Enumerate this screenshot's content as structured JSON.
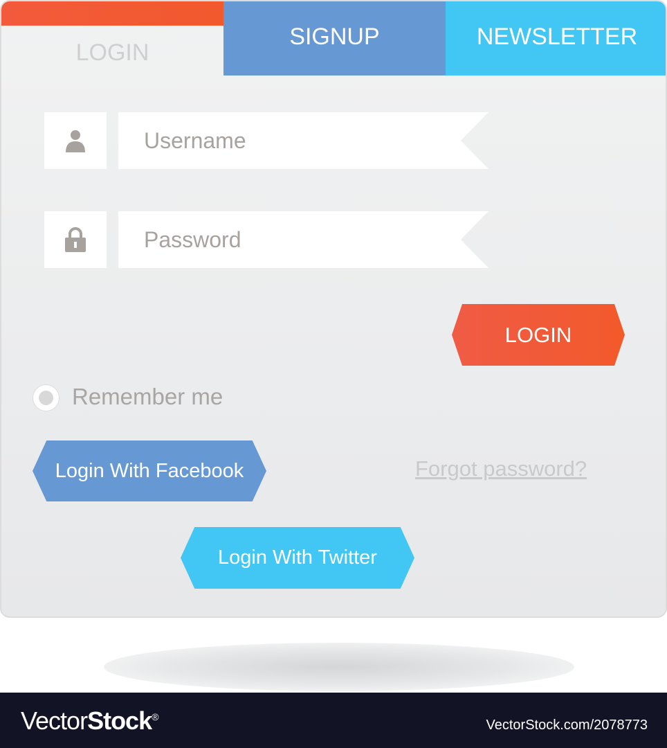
{
  "tabs": [
    {
      "label": "LOGIN",
      "active": true
    },
    {
      "label": "SIGNUP"
    },
    {
      "label": "NEWSLETTER"
    }
  ],
  "form": {
    "username_placeholder": "Username",
    "password_placeholder": "Password",
    "login_button": "LOGIN",
    "remember_me": "Remember me",
    "facebook_button": "Login With Facebook",
    "forgot_password": "Forgot password?",
    "twitter_button": "Login With Twitter"
  },
  "icons": {
    "username": "user-icon",
    "password": "lock-icon"
  },
  "colors": {
    "orange": "#f25a3a",
    "blue": "#6699d3",
    "cyan": "#42c6f4",
    "footer": "#121325"
  },
  "footer": {
    "logo_light": "Vector",
    "logo_bold": "Stock",
    "logo_mark": "®",
    "id": "VectorStock.com/2078773"
  }
}
